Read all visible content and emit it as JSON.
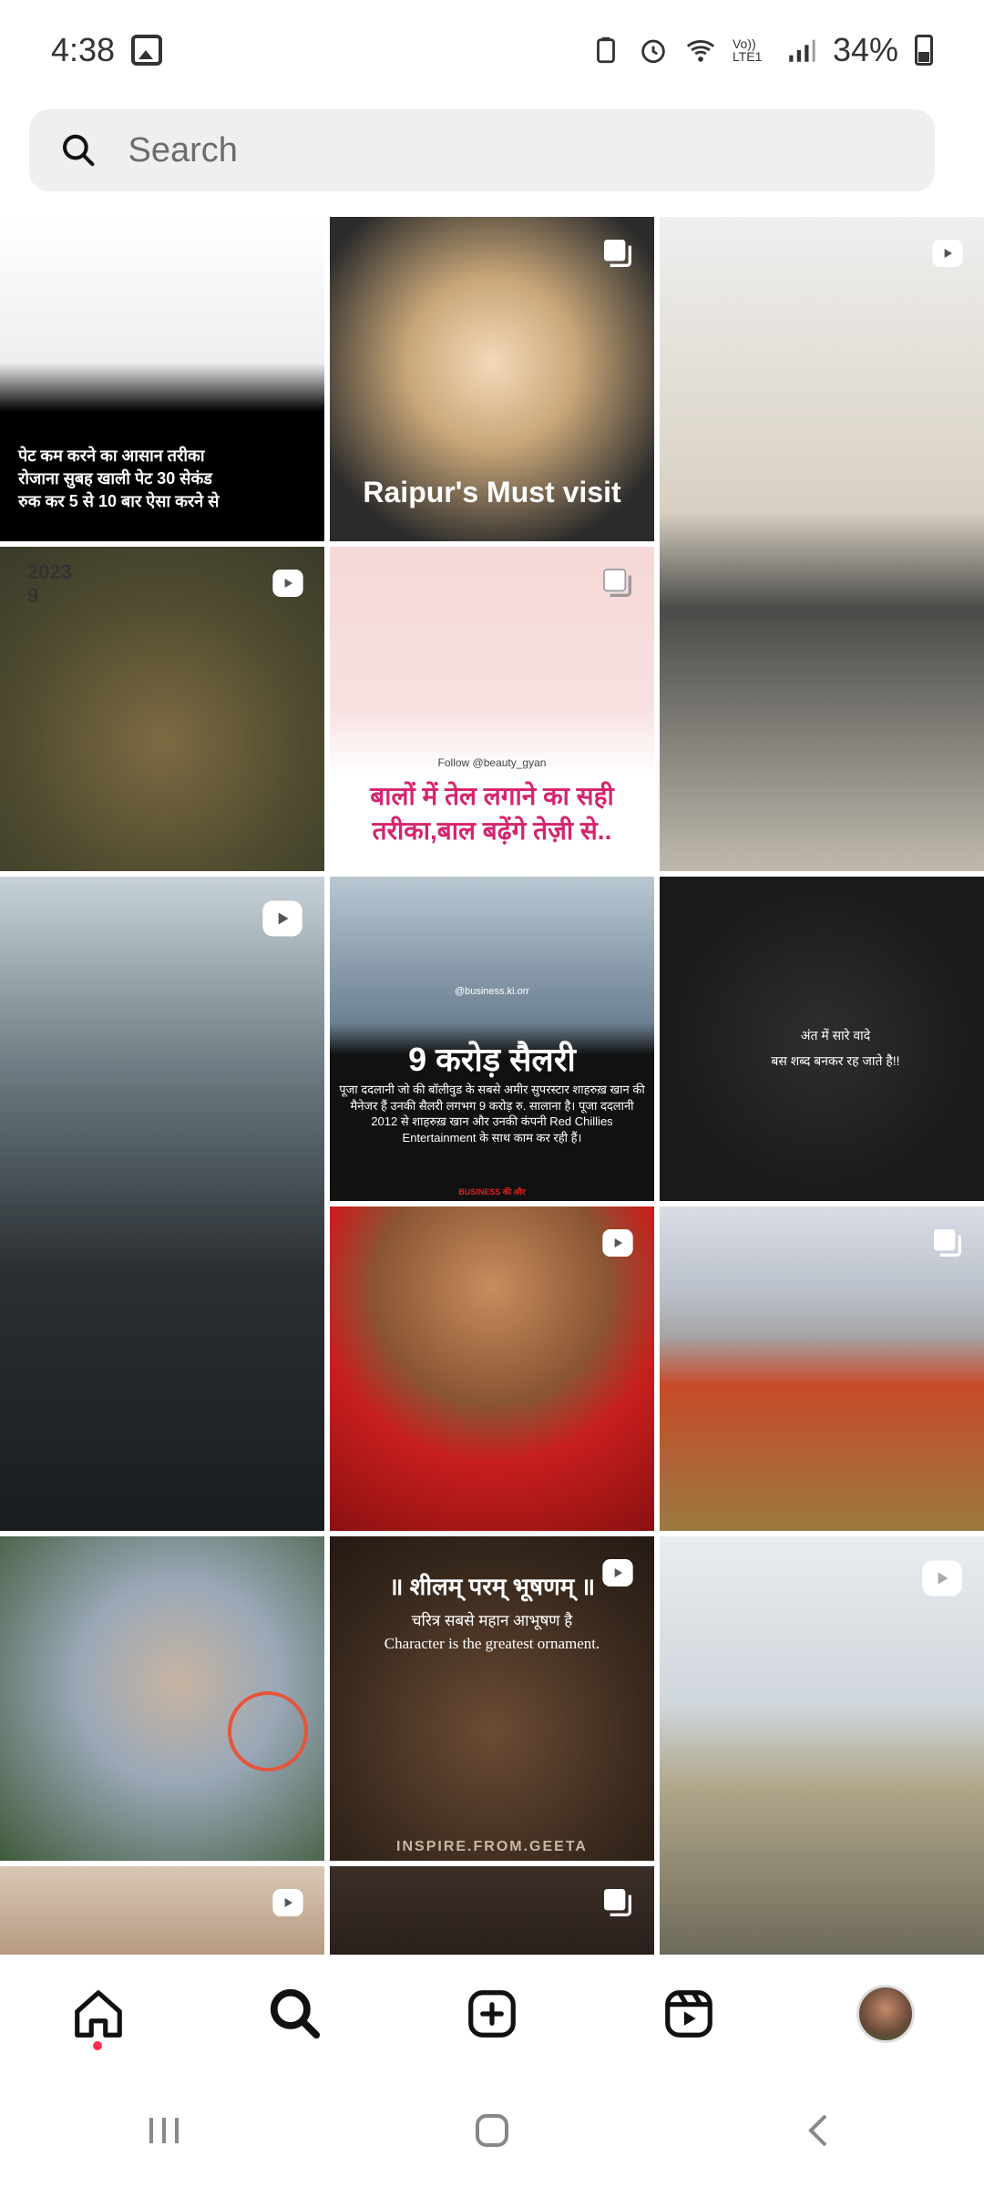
{
  "status_bar": {
    "time": "4:38",
    "volte_label": "Vo)) LTE1",
    "battery_percent": "34%"
  },
  "search": {
    "placeholder": "Search"
  },
  "grid": {
    "tiles": [
      {
        "type": "image",
        "text_lines": [
          "पेट कम करने का आसान तरीका",
          "रोजाना सुबह खाली पेट 30 सेकंड",
          "रुक कर 5 से 10 बार ऐसा करने से"
        ]
      },
      {
        "type": "carousel",
        "overlay_text": "Raipur's Must visit"
      },
      {
        "type": "reel"
      },
      {
        "type": "reel",
        "overlay_text": "2023 9"
      },
      {
        "type": "carousel",
        "credit_text": "Follow @beauty_gyan",
        "overlay_text": "बालों में तेल लगाने का सही तरीका,बाल बढ़ेंगे तेज़ी से.."
      },
      {
        "type": "reel"
      },
      {
        "type": "image",
        "handle": "@business.ki.orr",
        "headline": "9 करोड़ सैलरी",
        "body": "पूजा ददलानी जो की बॉलीवुड के सबसे अमीर सुपरस्टार शाहरुख़ खान की मैनेजर हैं उनकी सैलरी लगभग 9 करोड़ रु. सालाना है। पूजा ददलानी 2012 से शाहरुख़ खान और उनकी कंपनी Red Chillies Entertainment के साथ काम कर रही हैं।",
        "footer": "BUSINESS की और"
      },
      {
        "type": "image",
        "text_lines": [
          "अंत में सारे वादे",
          "बस शब्द बनकर रह जाते है!!"
        ]
      },
      {
        "type": "reel"
      },
      {
        "type": "carousel"
      },
      {
        "type": "image"
      },
      {
        "type": "reel",
        "heading": "॥ शीलम् परम् भूषणम् ॥",
        "sub": "चरित्र सबसे महान आभूषण है",
        "english": "Character is the greatest ornament.",
        "footer": "INSPIRE.FROM.GEETA"
      },
      {
        "type": "reel"
      },
      {
        "type": "reel"
      },
      {
        "type": "carousel"
      }
    ]
  },
  "bottom_nav": {
    "items": [
      "home",
      "search",
      "create",
      "reels",
      "profile"
    ],
    "active": "home"
  },
  "colors": {
    "background": "#ffffff",
    "search_bg": "#efefef",
    "notification_dot": "#ff2d55",
    "icon": "#111111"
  }
}
